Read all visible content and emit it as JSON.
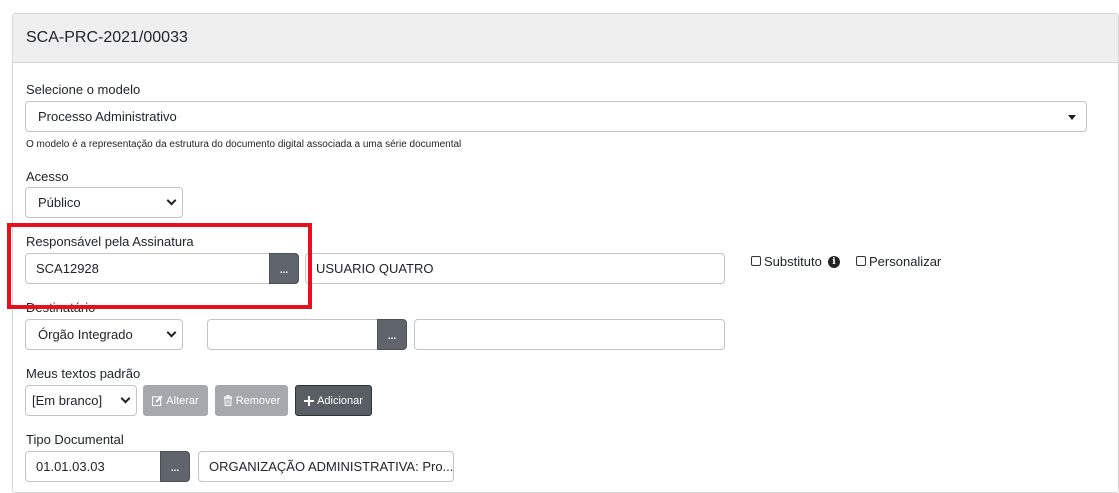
{
  "header": {
    "title": "SCA-PRC-2021/00033"
  },
  "modelo": {
    "label": "Selecione o modelo",
    "value": "Processo Administrativo",
    "help": "O modelo é a representação da estrutura do documento digital associada a uma série documental"
  },
  "acesso": {
    "label": "Acesso",
    "value": "Público"
  },
  "responsavel": {
    "label": "Responsável pela Assinatura",
    "code": "SCA12928",
    "lookup_label": "...",
    "name": "USUARIO QUATRO",
    "substituto_label": "Substituto",
    "personalizar_label": "Personalizar"
  },
  "destinatario": {
    "label": "Destinatário",
    "type_value": "Órgão Integrado",
    "code": "",
    "lookup_label": "...",
    "name": ""
  },
  "textos": {
    "label": "Meus textos padrão",
    "value": "[Em branco]",
    "alterar_label": "Alterar",
    "remover_label": "Remover",
    "adicionar_label": "Adicionar"
  },
  "tipo": {
    "label": "Tipo Documental",
    "code": "01.01.03.03",
    "lookup_label": "...",
    "name": "ORGANIZAÇÃO ADMINISTRATIVA: Pro..."
  },
  "colors": {
    "highlight": "#e8101a",
    "header_bg": "#efefef",
    "button_dark": "#5f656b",
    "button_disabled": "#a5a9ad"
  }
}
